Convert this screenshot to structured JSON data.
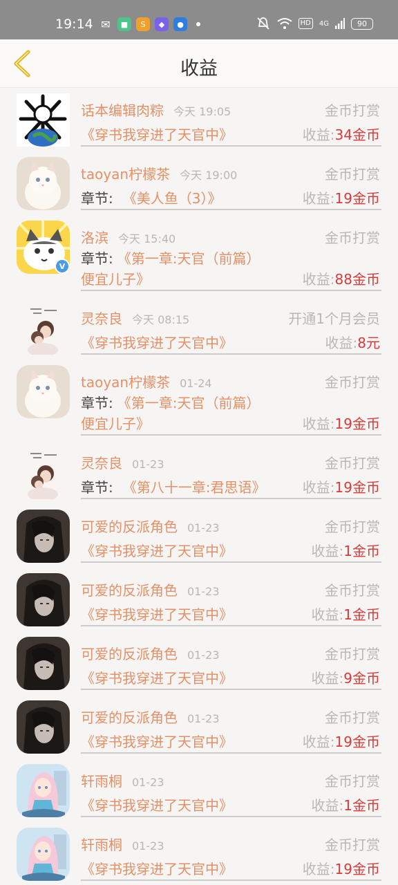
{
  "status_bar": {
    "time": "19:14",
    "network": "4G",
    "hd": "HD",
    "battery": "90"
  },
  "header": {
    "title": "收益"
  },
  "records": [
    {
      "name": "话本编辑肉粽",
      "time": "今天 19:05",
      "type": "金币打赏",
      "prefix": "",
      "book": "《穿书我穿进了天官中》",
      "book2": "",
      "income_label": "收益:",
      "income": "34金币"
    },
    {
      "name": "taoyan柠檬茶",
      "time": "今天 19:00",
      "type": "金币打赏",
      "prefix": "章节:",
      "book": "《美人鱼（3）》",
      "book2": "",
      "income_label": "收益:",
      "income": "19金币"
    },
    {
      "name": "洛滨",
      "time": "今天 15:40",
      "type": "金币打赏",
      "prefix": "章节:",
      "book": "《第一章:天官（前篇）",
      "book2": "便宜儿子》",
      "income_label": "收益:",
      "income": "88金币"
    },
    {
      "name": "灵奈良",
      "time": "今天 08:15",
      "type": "开通1个月会员",
      "prefix": "",
      "book": "《穿书我穿进了天官中》",
      "book2": "",
      "income_label": "收益:",
      "income": "8元"
    },
    {
      "name": "taoyan柠檬茶",
      "time": "01-24",
      "type": "金币打赏",
      "prefix": "章节:",
      "book": "《第一章:天官（前篇）",
      "book2": "便宜儿子》",
      "income_label": "收益:",
      "income": "19金币"
    },
    {
      "name": "灵奈良",
      "time": "01-23",
      "type": "金币打赏",
      "prefix": "章节:",
      "book": "《第八十一章:君思语》",
      "book2": "",
      "income_label": "收益:",
      "income": "19金币"
    },
    {
      "name": "可爱的反派角色",
      "time": "01-23",
      "type": "金币打赏",
      "prefix": "",
      "book": "《穿书我穿进了天官中》",
      "book2": "",
      "income_label": "收益:",
      "income": "1金币"
    },
    {
      "name": "可爱的反派角色",
      "time": "01-23",
      "type": "金币打赏",
      "prefix": "",
      "book": "《穿书我穿进了天官中》",
      "book2": "",
      "income_label": "收益:",
      "income": "1金币"
    },
    {
      "name": "可爱的反派角色",
      "time": "01-23",
      "type": "金币打赏",
      "prefix": "",
      "book": "《穿书我穿进了天官中》",
      "book2": "",
      "income_label": "收益:",
      "income": "9金币"
    },
    {
      "name": "可爱的反派角色",
      "time": "01-23",
      "type": "金币打赏",
      "prefix": "",
      "book": "《穿书我穿进了天官中》",
      "book2": "",
      "income_label": "收益:",
      "income": "19金币"
    },
    {
      "name": "轩雨桐",
      "time": "01-23",
      "type": "金币打赏",
      "prefix": "",
      "book": "《穿书我穿进了天官中》",
      "book2": "",
      "income_label": "收益:",
      "income": "1金币"
    },
    {
      "name": "轩雨桐",
      "time": "01-23",
      "type": "金币打赏",
      "prefix": "",
      "book": "《穿书我穿进了天官中》",
      "book2": "",
      "income_label": "收益:",
      "income": "19金币"
    }
  ],
  "colors": {
    "accent": "#e39066",
    "income": "#d83a3a",
    "muted": "#b9b6b3",
    "back_arrow": "#e0b41c"
  }
}
